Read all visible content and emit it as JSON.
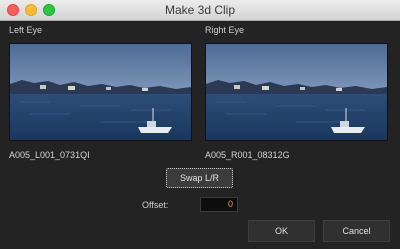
{
  "window": {
    "title": "Make 3d Clip"
  },
  "left_eye": {
    "label": "Left Eye",
    "filename": "A005_L001_0731QI"
  },
  "right_eye": {
    "label": "Right Eye",
    "filename": "A005_R001_08312G"
  },
  "swap_button": {
    "label": "Swap L/R"
  },
  "offset": {
    "label": "Offset:",
    "value": "0"
  },
  "buttons": {
    "ok": "OK",
    "cancel": "Cancel"
  },
  "colors": {
    "offset_value": "#e8a33a"
  }
}
